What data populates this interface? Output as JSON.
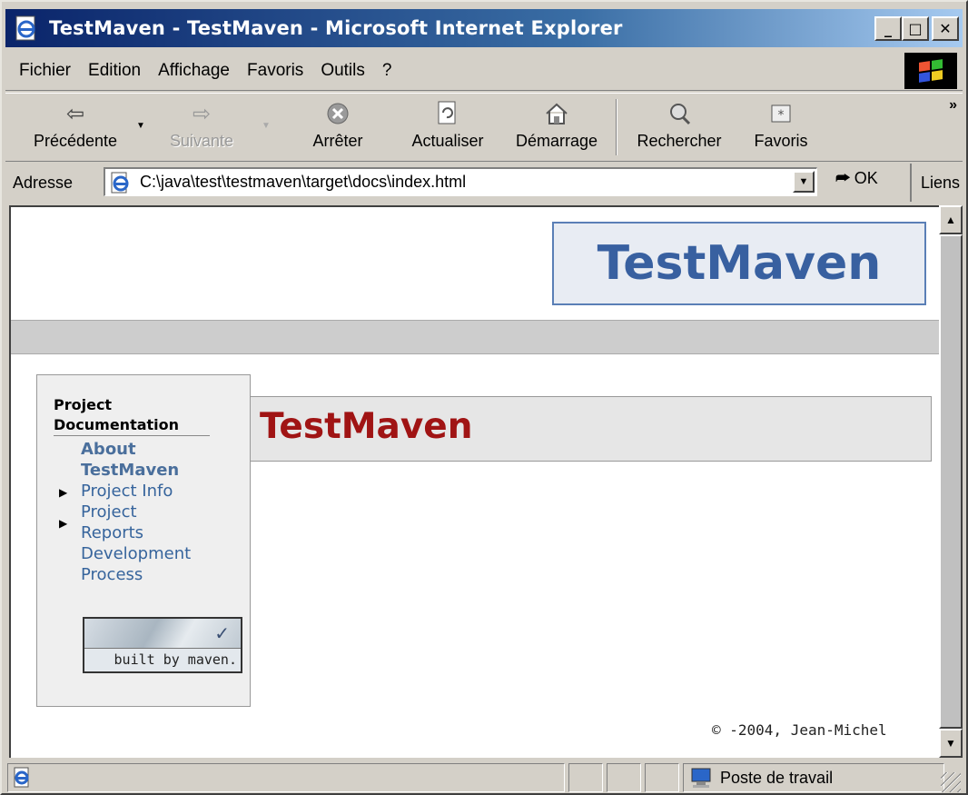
{
  "window": {
    "title": "TestMaven - TestMaven - Microsoft Internet Explorer",
    "buttons": {
      "minimize": "_",
      "maximize": "□",
      "close": "✕"
    }
  },
  "menubar": {
    "items": [
      {
        "label": "Fichier"
      },
      {
        "label": "Edition"
      },
      {
        "label": "Affichage"
      },
      {
        "label": "Favoris"
      },
      {
        "label": "Outils"
      },
      {
        "label": "?"
      }
    ]
  },
  "toolbar": {
    "back": {
      "label": "Précédente",
      "icon": "back-arrow-icon"
    },
    "forward": {
      "label": "Suivante",
      "icon": "forward-arrow-icon"
    },
    "stop": {
      "label": "Arrêter",
      "icon": "stop-icon"
    },
    "refresh": {
      "label": "Actualiser",
      "icon": "refresh-icon"
    },
    "home": {
      "label": "Démarrage",
      "icon": "home-icon"
    },
    "search": {
      "label": "Rechercher",
      "icon": "search-icon"
    },
    "favorites": {
      "label": "Favoris",
      "icon": "favorites-icon"
    },
    "more": "»"
  },
  "addressbar": {
    "label": "Adresse",
    "url": "C:\\java\\test\\testmaven\\target\\docs\\index.html",
    "go_label": "OK",
    "links_label": "Liens"
  },
  "page": {
    "banner_title": "TestMaven",
    "nav": {
      "heading": "Project Documentation",
      "items": [
        {
          "label": "About TestMaven",
          "current": true
        },
        {
          "label": "Project Info",
          "expandable": true
        },
        {
          "label": "Project Reports",
          "expandable": true
        },
        {
          "label": "Development Process"
        }
      ],
      "built_by": "built by maven."
    },
    "section_title": "TestMaven",
    "footer": "© -2004, Jean-Michel"
  },
  "statusbar": {
    "zone_label": "Poste de travail"
  },
  "colors": {
    "titlebar_start": "#0a246a",
    "banner_text": "#3860a0",
    "section_title": "#a01414",
    "nav_link": "#36649c"
  }
}
